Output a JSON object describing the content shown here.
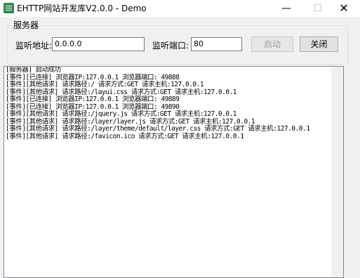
{
  "window": {
    "title": "EHTTP网站开发库V2.0.0 - Demo",
    "minimize_glyph": "—",
    "maximize_glyph": "☐",
    "close_glyph": "✕"
  },
  "server_group": {
    "legend": "服务器",
    "address_label": "监听地址:",
    "address_value": "0.0.0.0",
    "port_label": "监听端口:",
    "port_value": "80",
    "start_button": "启动",
    "stop_button": "关闭"
  },
  "log": {
    "lines": [
      "[服务器] 启动成功",
      "[事件][已连接] 浏览器IP:127.0.0.1 浏览器端口: 49888",
      "[事件][其他请求] 请求路径:/ 请求方式:GET 请求主机:127.0.0.1",
      "[事件][其他请求] 请求路径:/layui.css 请求方式:GET 请求主机:127.0.0.1",
      "[事件][已连接] 浏览器IP:127.0.0.1 浏览器端口: 49889",
      "[事件][已连接] 浏览器IP:127.0.0.1 浏览器端口: 49890",
      "[事件][其他请求] 请求路径:/jquery.js 请求方式:GET 请求主机:127.0.0.1",
      "[事件][其他请求] 请求路径:/layer/layer.js 请求方式:GET 请求主机:127.0.0.1",
      "[事件][其他请求] 请求路径:/layer/theme/default/layer.css 请求方式:GET 请求主机:127.0.0.1",
      "[事件][其他请求] 请求路径:/favicon.ico 请求方式:GET 请求主机:127.0.0.1"
    ]
  },
  "icons": {
    "app": "app-icon"
  }
}
